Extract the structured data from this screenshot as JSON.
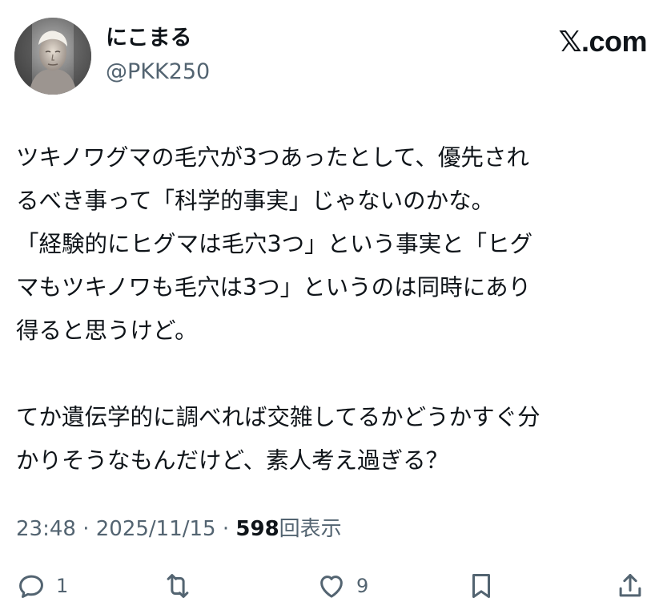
{
  "author": {
    "display_name": "にこまる",
    "handle": "@PKK250"
  },
  "brand": {
    "label": "𝕏.com"
  },
  "tweet": {
    "lines": [
      "ツキノワグマの毛穴が3つあったとして、優先され",
      "るべき事って「科学的事実」じゃないのかな。",
      "「経験的にヒグマは毛穴3つ」という事実と「ヒグ",
      "マもツキノワも毛穴は3つ」というのは同時にあり",
      "得ると思うけど。",
      "",
      "てか遺伝学的に調べれば交雑してるかどうかすぐ分",
      "かりそうなもんだけど、素人考え過ぎる？"
    ]
  },
  "meta": {
    "time": "23:48",
    "separator": "·",
    "date": "2025/11/15",
    "views_count": "598",
    "views_label": "回表示"
  },
  "actions": {
    "reply_icon": "reply-icon",
    "reply_count": "1",
    "retweet_icon": "retweet-icon",
    "like_icon": "heart-icon",
    "like_count": "9",
    "bookmark_icon": "bookmark-icon",
    "share_icon": "share-icon"
  },
  "colors": {
    "text": "#0f1419",
    "secondary": "#536471",
    "background": "#ffffff"
  }
}
